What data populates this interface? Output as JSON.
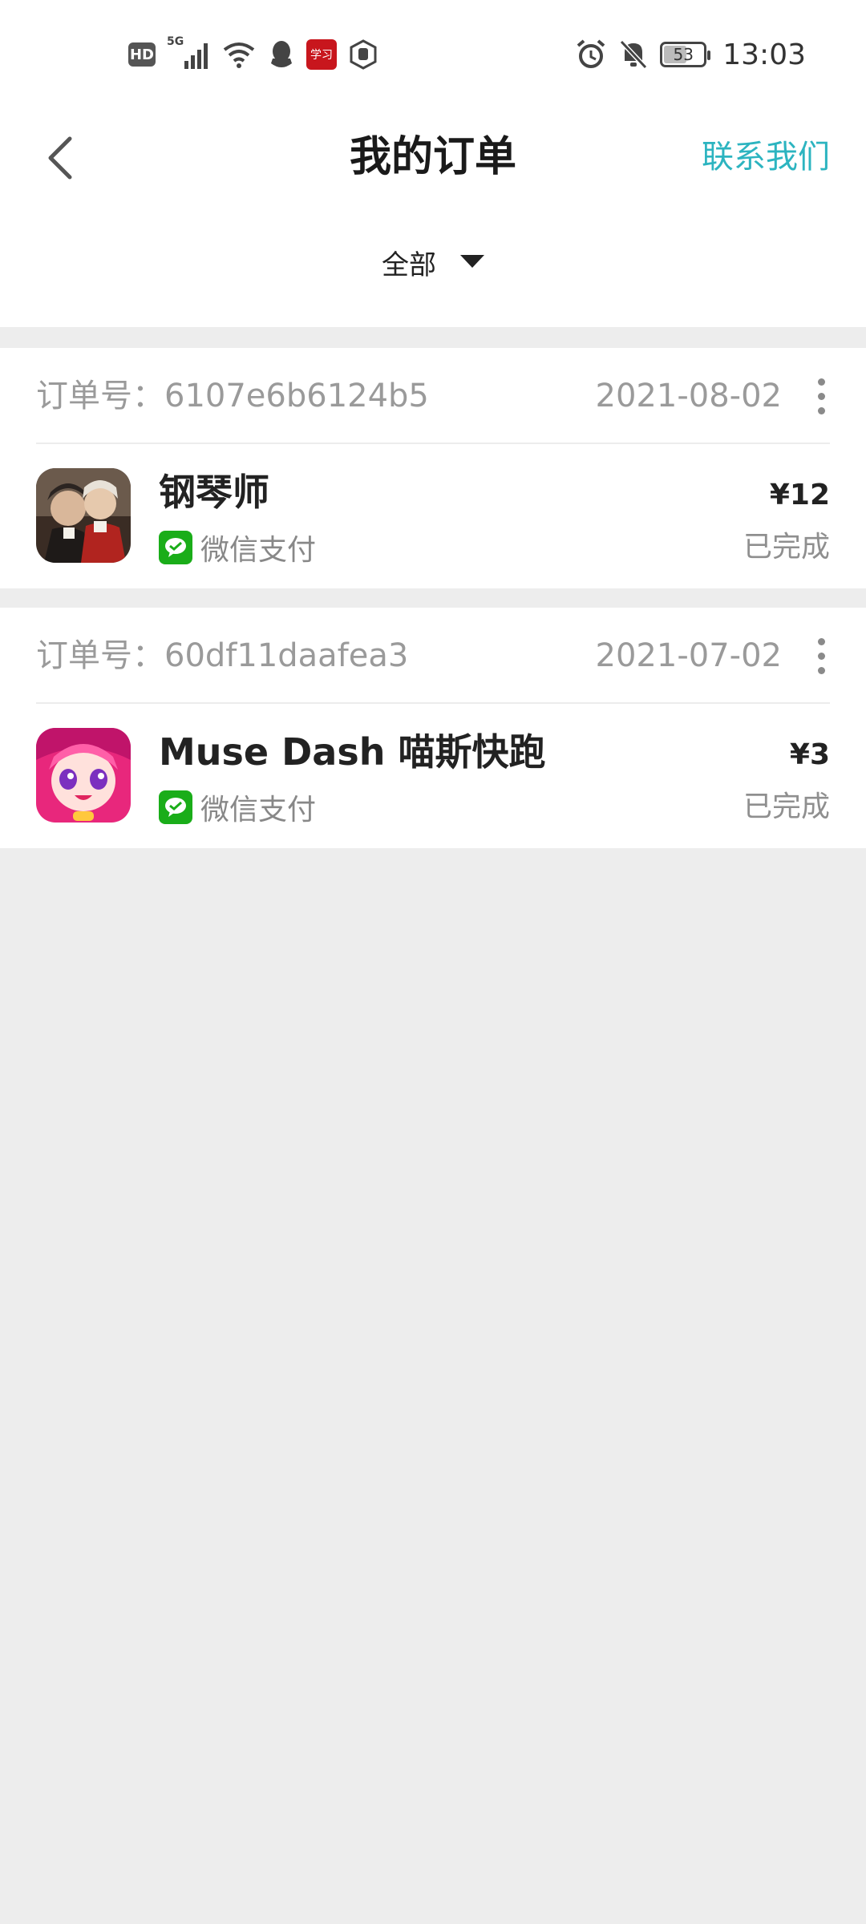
{
  "status_bar": {
    "time": "13:03",
    "battery_level": "53",
    "hd_label": "HD",
    "network_label": "5G",
    "red_app_label": "学习"
  },
  "header": {
    "title": "我的订单",
    "contact_label": "联系我们"
  },
  "filter": {
    "selected": "全部"
  },
  "orders": [
    {
      "order_no": "订单号：6107e6b6124b5",
      "date": "2021-08-02",
      "app_name": "钢琴师",
      "payment": "微信支付",
      "price": "¥12",
      "status": "已完成"
    },
    {
      "order_no": "订单号：60df11daafea3",
      "date": "2021-07-02",
      "app_name": "Muse Dash 喵斯快跑",
      "payment": "微信支付",
      "price": "¥3",
      "status": "已完成"
    }
  ],
  "colors": {
    "accent": "#2cb4c0",
    "wechat_green": "#1aad19",
    "page_bg": "#ededed"
  }
}
